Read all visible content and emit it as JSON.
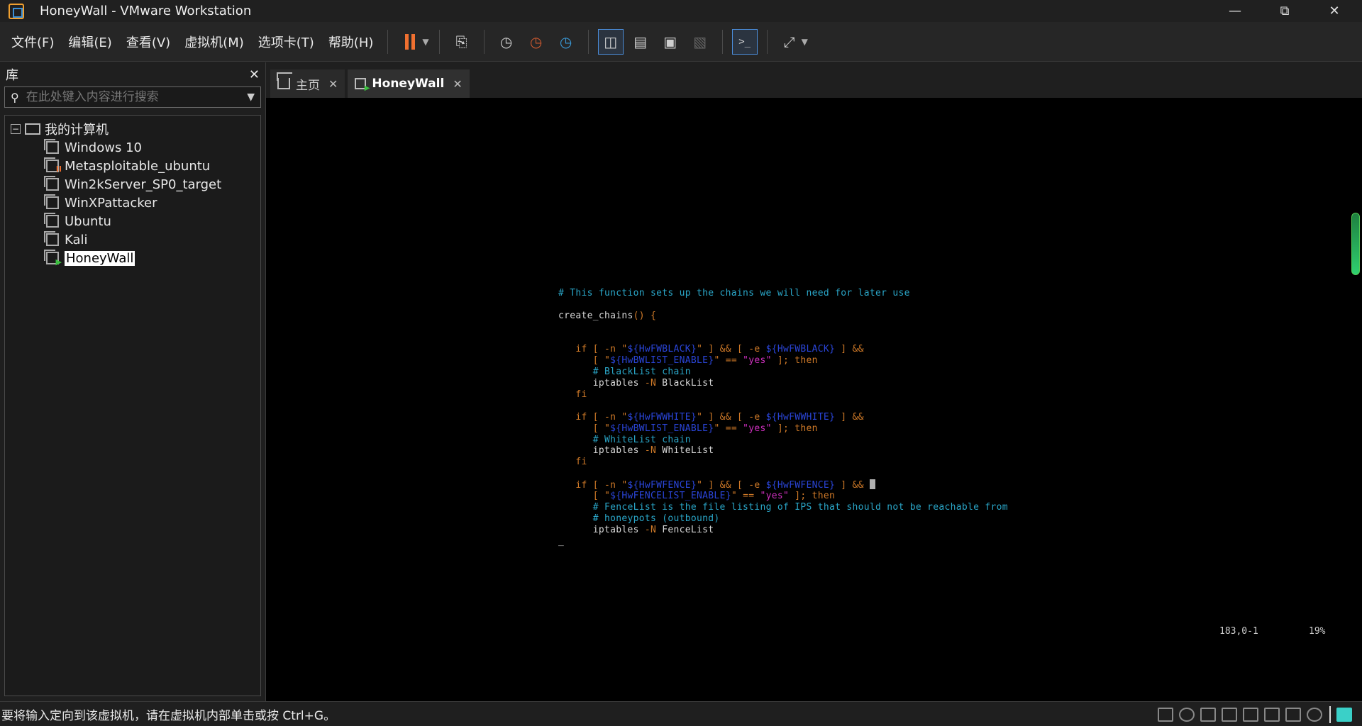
{
  "window": {
    "title": "HoneyWall - VMware Workstation",
    "minimize_icon": "minimize-icon",
    "maximize_icon": "restore-icon",
    "close_icon": "close-icon"
  },
  "menu": {
    "items": [
      "文件(F)",
      "编辑(E)",
      "查看(V)",
      "虚拟机(M)",
      "选项卡(T)",
      "帮助(H)"
    ]
  },
  "toolbar": {
    "icons": [
      "pause-icon",
      "send-ctrl-alt-del-icon",
      "snapshot-icon",
      "revert-snapshot-icon",
      "snapshot-manager-icon",
      "library-view-icon",
      "thumbnail-bar-icon",
      "fullscreen-icon",
      "unity-icon",
      "console-view-icon",
      "stretch-icon"
    ]
  },
  "library": {
    "title": "库",
    "search_placeholder": "在此处键入内容进行搜索",
    "root_label": "我的计算机",
    "vms": [
      {
        "name": "Windows 10",
        "state": "off"
      },
      {
        "name": "Metasploitable_ubuntu",
        "state": "paused"
      },
      {
        "name": "Win2kServer_SP0_target",
        "state": "off"
      },
      {
        "name": "WinXPattacker",
        "state": "off"
      },
      {
        "name": "Ubuntu",
        "state": "off"
      },
      {
        "name": "Kali",
        "state": "off"
      },
      {
        "name": "HoneyWall",
        "state": "running",
        "selected": true
      }
    ]
  },
  "tabs": [
    {
      "label": "主页",
      "icon": "home-icon"
    },
    {
      "label": "HoneyWall",
      "icon": "vm-running-icon",
      "active": true
    }
  ],
  "terminal": {
    "lines": [
      {
        "indent": "",
        "segments": [
          {
            "t": "# This function sets up the chains we will need for later use",
            "c": "cyan"
          }
        ]
      },
      {
        "indent": "",
        "segments": []
      },
      {
        "indent": "",
        "segments": [
          {
            "t": "create_chains",
            "c": "white"
          },
          {
            "t": "() {",
            "c": "orange"
          }
        ]
      },
      {
        "indent": "",
        "segments": []
      },
      {
        "indent": "",
        "segments": []
      },
      {
        "indent": "   ",
        "segments": [
          {
            "t": "if [ -n \"",
            "c": "orange"
          },
          {
            "t": "${HwFWBLACK}",
            "c": "blue"
          },
          {
            "t": "\" ] && [ -e ",
            "c": "orange"
          },
          {
            "t": "${HwFWBLACK}",
            "c": "blue"
          },
          {
            "t": " ] &&",
            "c": "orange"
          }
        ]
      },
      {
        "indent": "      ",
        "segments": [
          {
            "t": "[ \"",
            "c": "orange"
          },
          {
            "t": "${HwBWLIST_ENABLE}",
            "c": "blue"
          },
          {
            "t": "\" == ",
            "c": "orange"
          },
          {
            "t": "\"yes\"",
            "c": "magenta"
          },
          {
            "t": " ]; then",
            "c": "orange"
          }
        ]
      },
      {
        "indent": "      ",
        "segments": [
          {
            "t": "# BlackList chain",
            "c": "cyan"
          }
        ]
      },
      {
        "indent": "      ",
        "segments": [
          {
            "t": "iptables ",
            "c": "white"
          },
          {
            "t": "-N",
            "c": "orange"
          },
          {
            "t": " BlackList",
            "c": "white"
          }
        ]
      },
      {
        "indent": "   ",
        "segments": [
          {
            "t": "fi",
            "c": "orange"
          }
        ]
      },
      {
        "indent": "",
        "segments": []
      },
      {
        "indent": "   ",
        "segments": [
          {
            "t": "if [ -n \"",
            "c": "orange"
          },
          {
            "t": "${HwFWWHITE}",
            "c": "blue"
          },
          {
            "t": "\" ] && [ -e ",
            "c": "orange"
          },
          {
            "t": "${HwFWWHITE}",
            "c": "blue"
          },
          {
            "t": " ] &&",
            "c": "orange"
          }
        ]
      },
      {
        "indent": "      ",
        "segments": [
          {
            "t": "[ \"",
            "c": "orange"
          },
          {
            "t": "${HwBWLIST_ENABLE}",
            "c": "blue"
          },
          {
            "t": "\" == ",
            "c": "orange"
          },
          {
            "t": "\"yes\"",
            "c": "magenta"
          },
          {
            "t": " ]; then",
            "c": "orange"
          }
        ]
      },
      {
        "indent": "      ",
        "segments": [
          {
            "t": "# WhiteList chain",
            "c": "cyan"
          }
        ]
      },
      {
        "indent": "      ",
        "segments": [
          {
            "t": "iptables ",
            "c": "white"
          },
          {
            "t": "-N",
            "c": "orange"
          },
          {
            "t": " WhiteList",
            "c": "white"
          }
        ]
      },
      {
        "indent": "   ",
        "segments": [
          {
            "t": "fi",
            "c": "orange"
          }
        ]
      },
      {
        "indent": "",
        "segments": []
      },
      {
        "indent": "   ",
        "segments": [
          {
            "t": "if [ -n \"",
            "c": "orange"
          },
          {
            "t": "${HwFWFENCE}",
            "c": "blue"
          },
          {
            "t": "\" ] && [ -e ",
            "c": "orange"
          },
          {
            "t": "${HwFWFENCE}",
            "c": "blue"
          },
          {
            "t": " ] && ",
            "c": "orange"
          },
          {
            "t": "",
            "c": "cursor"
          }
        ]
      },
      {
        "indent": "      ",
        "segments": [
          {
            "t": "[ \"",
            "c": "orange"
          },
          {
            "t": "${HwFENCELIST_ENABLE}",
            "c": "blue"
          },
          {
            "t": "\" == ",
            "c": "orange"
          },
          {
            "t": "\"yes\"",
            "c": "magenta"
          },
          {
            "t": " ]; then",
            "c": "orange"
          }
        ]
      },
      {
        "indent": "      ",
        "segments": [
          {
            "t": "# FenceList is the file listing of IPS that should not be reachable from",
            "c": "cyan"
          }
        ]
      },
      {
        "indent": "      ",
        "segments": [
          {
            "t": "# honeypots (outbound)",
            "c": "cyan"
          }
        ]
      },
      {
        "indent": "      ",
        "segments": [
          {
            "t": "iptables ",
            "c": "white"
          },
          {
            "t": "-N",
            "c": "orange"
          },
          {
            "t": " FenceList",
            "c": "white"
          }
        ]
      },
      {
        "indent": "",
        "segments": [
          {
            "t": "_",
            "c": "white"
          }
        ]
      }
    ],
    "cursor_position": "183,0-1",
    "scroll_percent": "19%"
  },
  "status_message": "要将输入定向到该虚拟机，请在虚拟机内部单击或按 Ctrl+G。",
  "device_icons": [
    "hard-disk-icon",
    "cd-rom-icon",
    "network-adapter-1-icon",
    "network-adapter-2-icon",
    "network-adapter-3-icon",
    "printer-icon",
    "sound-card-icon",
    "display-icon",
    "message-icon"
  ],
  "colors": {
    "cyan": "#2aa6c8",
    "orange": "#d07a28",
    "blue": "#2a45d8",
    "magenta": "#d030c0",
    "white": "#d8d8d8",
    "running_green": "#3cc040",
    "pause_orange": "#f07030"
  }
}
